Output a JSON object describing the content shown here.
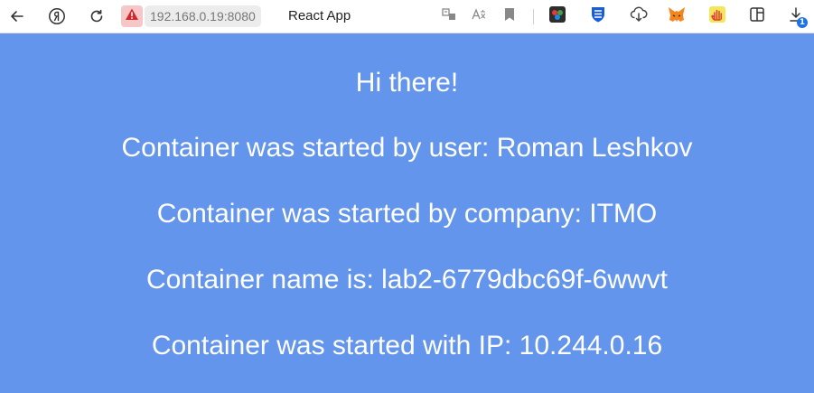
{
  "browser": {
    "url": "192.168.0.19:8080",
    "tab_title": "React App",
    "download_badge": "1",
    "icons": [
      "back-icon",
      "yandex-icon",
      "reload-icon",
      "not-secure-warning-icon",
      "translate-page-icon",
      "read-aloud-icon",
      "bookmark-icon",
      "color-picker-extension-icon",
      "bitwarden-extension-icon",
      "cloud-download-extension-icon",
      "metamask-extension-icon",
      "hand-extension-icon",
      "sidebar-icon",
      "downloads-icon"
    ]
  },
  "page": {
    "background": "#6495ed",
    "text_color": "#ffffff",
    "greeting": "Hi there!",
    "user_line": "Container was started by user: Roman Leshkov",
    "company_line": "Container was started by company: ITMO",
    "name_line": "Container name is: lab2-6779dbc69f-6wwvt",
    "ip_line": "Container was started with IP: 10.244.0.16"
  }
}
